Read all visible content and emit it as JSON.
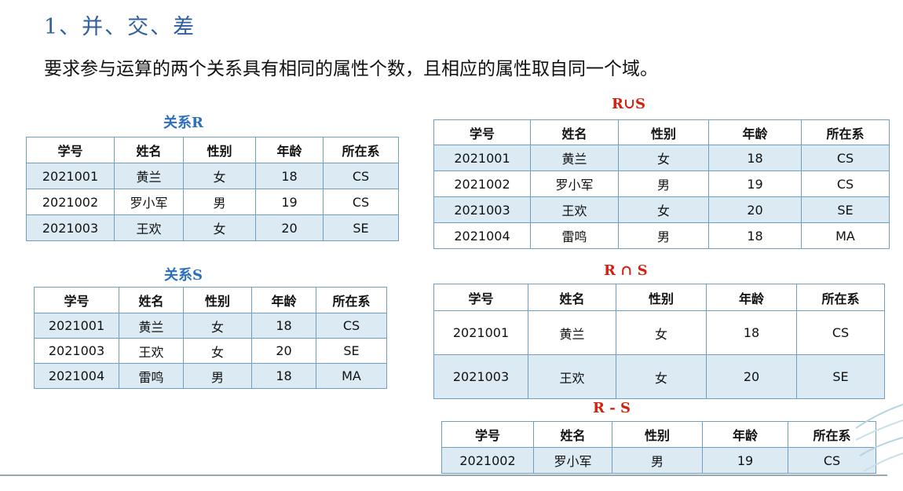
{
  "heading": "1、并、交、差",
  "subheading": "要求参与运算的两个关系具有相同的属性个数，且相应的属性取自同一个域。",
  "columns": [
    "学号",
    "姓名",
    "性别",
    "年龄",
    "所在系"
  ],
  "tables": [
    {
      "caption": "关系R",
      "rows": [
        [
          "2021001",
          "黄兰",
          "女",
          "18",
          "CS"
        ],
        [
          "2021002",
          "罗小军",
          "男",
          "19",
          "CS"
        ],
        [
          "2021003",
          "王欢",
          "女",
          "20",
          "SE"
        ]
      ]
    },
    {
      "caption": "关系S",
      "rows": [
        [
          "2021001",
          "黄兰",
          "女",
          "18",
          "CS"
        ],
        [
          "2021003",
          "王欢",
          "女",
          "20",
          "SE"
        ],
        [
          "2021004",
          "雷鸣",
          "男",
          "18",
          "MA"
        ]
      ]
    },
    {
      "caption": "R∪S",
      "rows": [
        [
          "2021001",
          "黄兰",
          "女",
          "18",
          "CS"
        ],
        [
          "2021002",
          "罗小军",
          "男",
          "19",
          "CS"
        ],
        [
          "2021003",
          "王欢",
          "女",
          "20",
          "SE"
        ],
        [
          "2021004",
          "雷鸣",
          "男",
          "18",
          "MA"
        ]
      ]
    },
    {
      "caption": "R ∩ S",
      "rows": [
        [
          "2021001",
          "黄兰",
          "女",
          "18",
          "CS"
        ],
        [
          "2021003",
          "王欢",
          "女",
          "20",
          "SE"
        ]
      ]
    },
    {
      "caption": "R - S",
      "rows": [
        [
          "2021002",
          "罗小军",
          "男",
          "19",
          "CS"
        ]
      ]
    }
  ],
  "colors": {
    "heading": "#2f5f9e",
    "caption_blue": "#2c6fbe",
    "caption_red": "#d51f0f",
    "row_alt": "#dcebf3",
    "border": "#6f9ec2"
  }
}
